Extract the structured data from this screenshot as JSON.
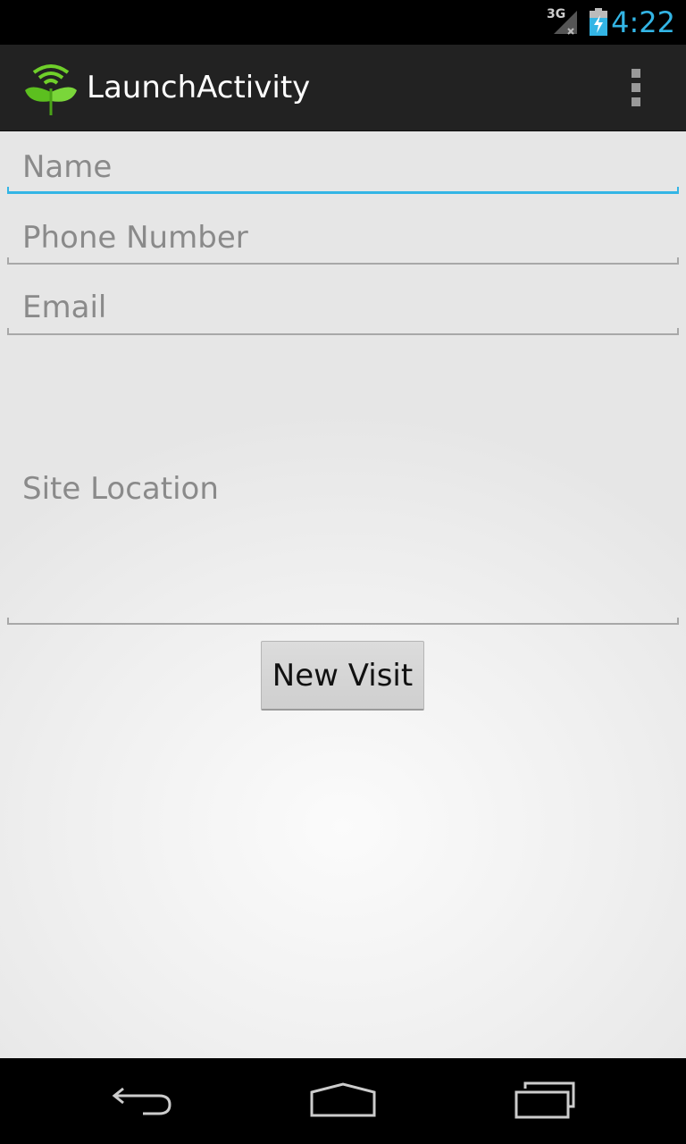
{
  "status_bar": {
    "network": "3G",
    "time": "4:22",
    "time_color": "#33b5e5",
    "icons": [
      "signal-icon",
      "battery-charging-icon"
    ]
  },
  "action_bar": {
    "title": "LaunchActivity",
    "icons": [
      "app-logo-icon",
      "overflow-menu-icon"
    ]
  },
  "form": {
    "name_placeholder": "Name",
    "phone_placeholder": "Phone Number",
    "email_placeholder": "Email",
    "site_location_placeholder": "Site Location",
    "focused_field": "Name",
    "focus_color": "#33b5e5",
    "button_label": "New Visit"
  },
  "nav_bar": {
    "icons": [
      "back-icon",
      "home-icon",
      "recent-apps-icon"
    ]
  }
}
